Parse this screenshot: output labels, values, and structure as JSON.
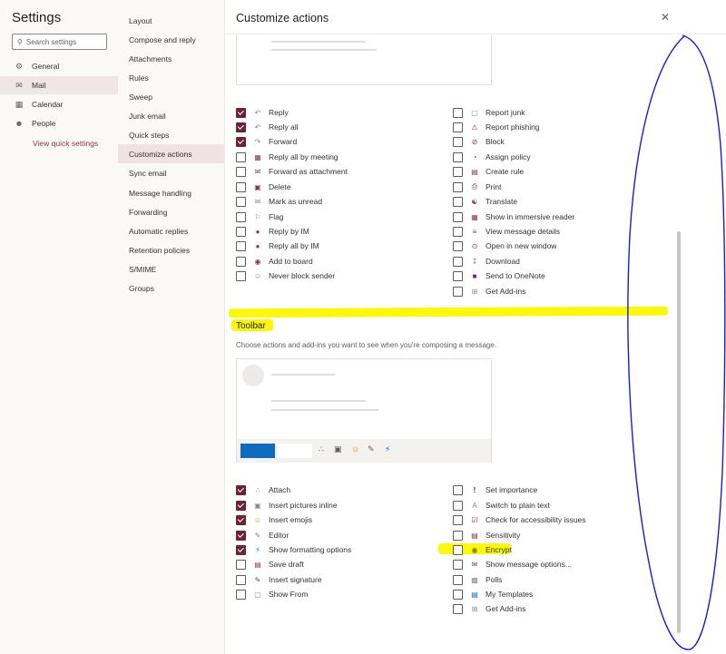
{
  "app_title": "Settings",
  "search": {
    "placeholder": "Search settings"
  },
  "left_nav": [
    {
      "label": "General",
      "icon": "gear-icon"
    },
    {
      "label": "Mail",
      "icon": "mail-icon",
      "selected": true
    },
    {
      "label": "Calendar",
      "icon": "calendar-icon"
    },
    {
      "label": "People",
      "icon": "people-icon"
    }
  ],
  "view_quick_settings": "View quick settings",
  "mail_subnav": [
    "Layout",
    "Compose and reply",
    "Attachments",
    "Rules",
    "Sweep",
    "Junk email",
    "Quick steps",
    "Customize actions",
    "Sync email",
    "Message handling",
    "Forwarding",
    "Automatic replies",
    "Retention policies",
    "S/MIME",
    "Groups"
  ],
  "selected_subnav": "Customize actions",
  "page_title": "Customize actions",
  "message_actions": {
    "left": [
      {
        "label": "Reply",
        "checked": true,
        "icon": "reply-icon"
      },
      {
        "label": "Reply all",
        "checked": true,
        "icon": "reply-all-icon"
      },
      {
        "label": "Forward",
        "checked": true,
        "icon": "forward-icon"
      },
      {
        "label": "Reply all by meeting",
        "checked": false,
        "icon": "calendar-reply-icon"
      },
      {
        "label": "Forward as attachment",
        "checked": false,
        "icon": "forward-attachment-icon"
      },
      {
        "label": "Delete",
        "checked": false,
        "icon": "trash-icon"
      },
      {
        "label": "Mark as unread",
        "checked": false,
        "icon": "envelope-icon"
      },
      {
        "label": "Flag",
        "checked": false,
        "icon": "flag-icon"
      },
      {
        "label": "Reply by IM",
        "checked": false,
        "icon": "chat-icon"
      },
      {
        "label": "Reply all by IM",
        "checked": false,
        "icon": "chat-all-icon"
      },
      {
        "label": "Add to board",
        "checked": false,
        "icon": "board-icon"
      },
      {
        "label": "Never block sender",
        "checked": false,
        "icon": "person-check-icon"
      }
    ],
    "right": [
      {
        "label": "Report junk",
        "checked": false,
        "icon": "junk-icon"
      },
      {
        "label": "Report phishing",
        "checked": false,
        "icon": "phishing-icon"
      },
      {
        "label": "Block",
        "checked": false,
        "icon": "block-icon"
      },
      {
        "label": "Assign policy",
        "checked": false,
        "icon": "policy-icon"
      },
      {
        "label": "Create rule",
        "checked": false,
        "icon": "rule-icon"
      },
      {
        "label": "Print",
        "checked": false,
        "icon": "print-icon"
      },
      {
        "label": "Translate",
        "checked": false,
        "icon": "translate-icon"
      },
      {
        "label": "Show in immersive reader",
        "checked": false,
        "icon": "reader-icon"
      },
      {
        "label": "View message details",
        "checked": false,
        "icon": "details-icon"
      },
      {
        "label": "Open in new window",
        "checked": false,
        "icon": "new-window-icon"
      },
      {
        "label": "Download",
        "checked": false,
        "icon": "download-icon"
      },
      {
        "label": "Send to OneNote",
        "checked": false,
        "icon": "onenote-icon"
      },
      {
        "label": "Get Add-ins",
        "checked": false,
        "icon": "addins-icon"
      }
    ]
  },
  "toolbar_section": {
    "title": "Toolbar",
    "description": "Choose actions and add-ins you want to see when you're composing a message."
  },
  "toolbar_actions": {
    "left": [
      {
        "label": "Attach",
        "checked": true,
        "icon": "paperclip-icon"
      },
      {
        "label": "Insert pictures inline",
        "checked": true,
        "icon": "picture-icon"
      },
      {
        "label": "Insert emojis",
        "checked": true,
        "icon": "emoji-icon"
      },
      {
        "label": "Editor",
        "checked": true,
        "icon": "editor-pen-icon"
      },
      {
        "label": "Show formatting options",
        "checked": true,
        "icon": "formatting-icon"
      },
      {
        "label": "Save draft",
        "checked": false,
        "icon": "save-icon"
      },
      {
        "label": "Insert signature",
        "checked": false,
        "icon": "signature-icon"
      },
      {
        "label": "Show From",
        "checked": false,
        "icon": "from-icon"
      }
    ],
    "right": [
      {
        "label": "Set importance",
        "checked": false,
        "icon": "importance-icon"
      },
      {
        "label": "Switch to plain text",
        "checked": false,
        "icon": "plain-text-icon"
      },
      {
        "label": "Check for accessibility issues",
        "checked": false,
        "icon": "accessibility-icon"
      },
      {
        "label": "Sensitivity",
        "checked": false,
        "icon": "sensitivity-icon"
      },
      {
        "label": "Encrypt",
        "checked": false,
        "icon": "encrypt-icon"
      },
      {
        "label": "Show message options...",
        "checked": false,
        "icon": "message-options-icon"
      },
      {
        "label": "Polls",
        "checked": false,
        "icon": "polls-icon"
      },
      {
        "label": "My Templates",
        "checked": false,
        "icon": "templates-icon"
      },
      {
        "label": "Get Add-ins",
        "checked": false,
        "icon": "addins-icon"
      }
    ]
  },
  "colors": {
    "accent": "#6b2338",
    "highlight": "#fbf70f",
    "pen": "#1a1acf"
  }
}
